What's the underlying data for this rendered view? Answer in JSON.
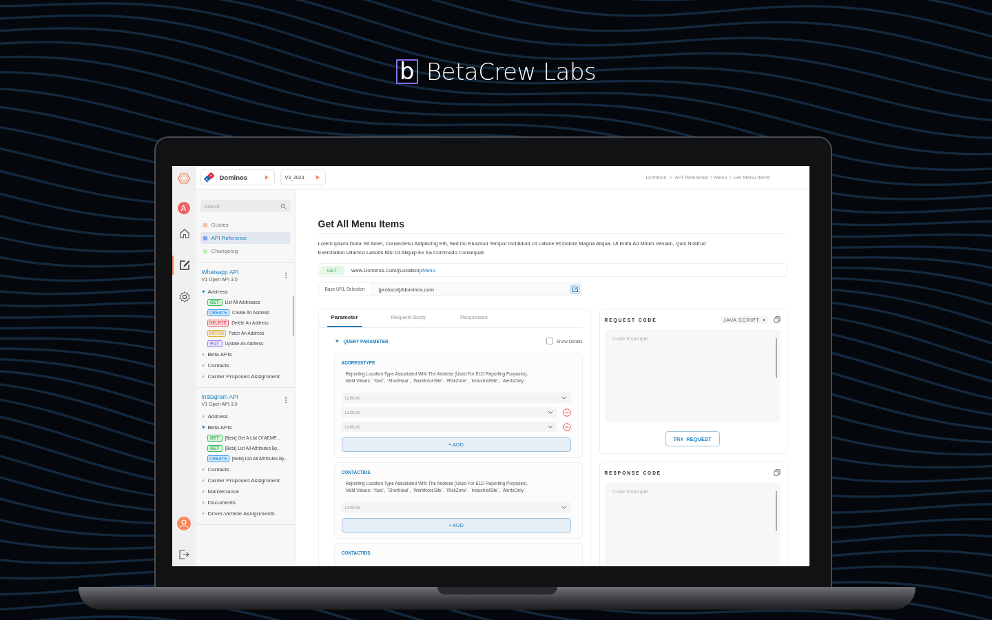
{
  "brand": {
    "mark": "b",
    "name": "BetaCrew Labs"
  },
  "topbar": {
    "project": "Dominos",
    "version": "V3_2023",
    "breadcrumb": "Dominos  >  API Reference > Menu > Get Menu Items"
  },
  "rail": {
    "avatar": "A",
    "items": [
      {
        "kind": "home",
        "selected": false
      },
      {
        "kind": "edit",
        "selected": true
      },
      {
        "kind": "settings",
        "selected": false
      }
    ]
  },
  "sidebar": {
    "search": {
      "placeholder": "Search"
    },
    "nav": [
      {
        "label": "Guides",
        "color": "#f9bca6",
        "selected": false
      },
      {
        "label": "API Reference",
        "color": "#7f9cf5",
        "selected": true
      },
      {
        "label": "Changelog",
        "color": "#b9ecb4",
        "selected": false
      }
    ],
    "apis": [
      {
        "title": "Whatsapp API",
        "subtitle": "V1 Open API 3.0",
        "groups": [
          {
            "label": "Address",
            "expanded": true,
            "children": [
              {
                "method": "GET",
                "color": "#3cba5a",
                "label": "List All Addresses"
              },
              {
                "method": "CREATE",
                "color": "#3b9be8",
                "label": "Create An Address"
              },
              {
                "method": "DELETE",
                "color": "#ef5b6b",
                "label": "Delete An Address"
              },
              {
                "method": "PATCH",
                "color": "#e0b13a",
                "label": "Patch An Address"
              },
              {
                "method": "PUT",
                "color": "#9a7cf0",
                "label": "Update An Address"
              }
            ]
          },
          {
            "label": "Beta APIs",
            "expanded": false
          },
          {
            "label": "Contacts",
            "expanded": false
          },
          {
            "label": "Carrier Proposed Assignment",
            "expanded": false
          }
        ]
      },
      {
        "title": "Instagram API",
        "subtitle": "V1 Open API 3.0",
        "groups": [
          {
            "label": "Address",
            "expanded": false
          },
          {
            "label": "Beta APIs",
            "expanded": true,
            "children": [
              {
                "method": "GET",
                "color": "#3cba5a",
                "label": "[Beta] Get A List Of AEMP..."
              },
              {
                "method": "GET",
                "color": "#3cba5a",
                "label": "[Beta] List All Attributes By..."
              },
              {
                "method": "CREATE",
                "color": "#3b9be8",
                "label": "[Beta] List All Attributes By..."
              }
            ]
          },
          {
            "label": "Contacts",
            "expanded": false
          },
          {
            "label": "Carrier Proposed Assignment",
            "expanded": false
          },
          {
            "label": "Maintenance",
            "expanded": false
          },
          {
            "label": "Documents",
            "expanded": false
          },
          {
            "label": "Driver-Vehicle Assignments",
            "expanded": false
          }
        ]
      }
    ]
  },
  "page": {
    "title": "Get All Menu Items",
    "description": "Lorem Ipsum Dolor Sit Amet, Consectetur Adipiscing Elit, Sed Do Eiusmod Tempor Incididunt Ut Labore Et Dolore Magna Aliqua. Ut Enim Ad Minim Veniam, Quis Nostrud Exercitation Ullamco Laboris Nisi Ut Aliquip Ex Ea Commodo Consequat.",
    "endpoint": {
      "method": "GET",
      "url": "www.Dominos.Com/{Location}/",
      "link": "Menu"
    },
    "base_url": {
      "label": "Base URL Selection",
      "value": "{protocol}//dominos.com"
    },
    "tabs": [
      {
        "label": "Parameter",
        "selected": true
      },
      {
        "label": "Request Body",
        "selected": false
      },
      {
        "label": "Responses",
        "selected": false
      }
    ],
    "query": {
      "label": "QUERY PARAMETER",
      "expanded": true,
      "show_details": {
        "label": "Show Details",
        "checked": false
      }
    },
    "params": [
      {
        "name": "ADDRESSTYPE",
        "lines": [
          "Reporting Location Type Associated With The Address (Used For ELD Reporting Purposes).",
          "Valid Values: `Yard`, `ShortHaul`, `WorkforceSite`, `RiskZone`, `IndustrialSite`, `AlertsOnly`."
        ],
        "selects": [
          {
            "placeholder": "Latitude",
            "removable": false
          },
          {
            "placeholder": "Latitude",
            "removable": true
          },
          {
            "placeholder": "Latitude",
            "removable": true
          }
        ],
        "add": "+ ADD"
      },
      {
        "name": "CONTACTIDS",
        "lines": [
          "Reporting Location Type Associated With The Address (Used For ELD Reporting Purposes).",
          "Valid Values: `Yard`, `ShortHaul`, `WorkforceSite`, `RiskZone`, `IndustrialSite`, `AlertsOnly`."
        ],
        "selects": [
          {
            "placeholder": "Latitude",
            "removable": false
          }
        ],
        "add": "+ ADD"
      },
      {
        "name": "CONTACTIDS"
      }
    ]
  },
  "request_code": {
    "title": "REQUEST CODE",
    "language": "JAVA SCRIPT",
    "placeholder": "Code Example",
    "button": "TRY  REQUEST"
  },
  "response_code": {
    "title": "RESPONSE CODE",
    "placeholder": "Code Example"
  }
}
